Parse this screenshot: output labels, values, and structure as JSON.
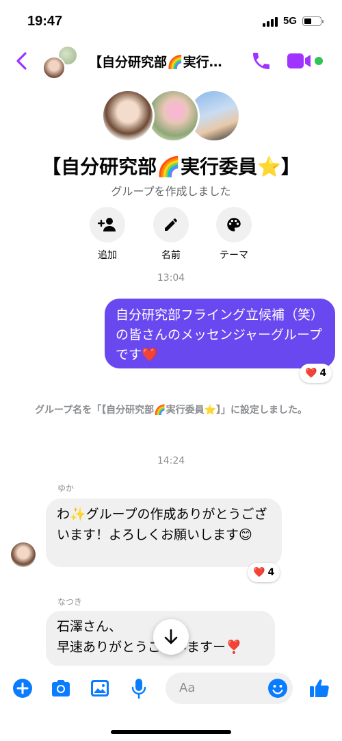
{
  "status_bar": {
    "time": "19:47",
    "network": "5G"
  },
  "header": {
    "title": "【自分研究部🌈実行…"
  },
  "group": {
    "name": "【自分研究部🌈実行委員⭐️】",
    "subtitle": "グループを作成しました",
    "actions": [
      {
        "label": "追加",
        "icon": "add-person-icon"
      },
      {
        "label": "名前",
        "icon": "pencil-icon"
      },
      {
        "label": "テーマ",
        "icon": "palette-icon"
      }
    ]
  },
  "messages": {
    "time1": "13:04",
    "outgoing": {
      "text": "自分研究部フライング立候補（笑）の皆さんのメッセンジャーグループです❤️",
      "reaction_emoji": "❤️",
      "reaction_count": "4"
    },
    "system": "グループ名を「【自分研究部🌈実行委員⭐️】」に設定しました。",
    "time2": "14:24",
    "yuka": {
      "sender": "ゆか",
      "text": "わ✨グループの作成ありがとうございます！よろしくお願いします😊",
      "reaction_emoji": "❤️",
      "reaction_count": "4"
    },
    "natsuki": {
      "sender": "なつき",
      "text": "石澤さん、\n早速ありがとうございますー❣️"
    }
  },
  "composer": {
    "placeholder": "Aa"
  },
  "colors": {
    "accent": "#a033ff",
    "bubble": "#6a48f0",
    "composer_icon": "#0a7cff",
    "online": "#31c454"
  }
}
